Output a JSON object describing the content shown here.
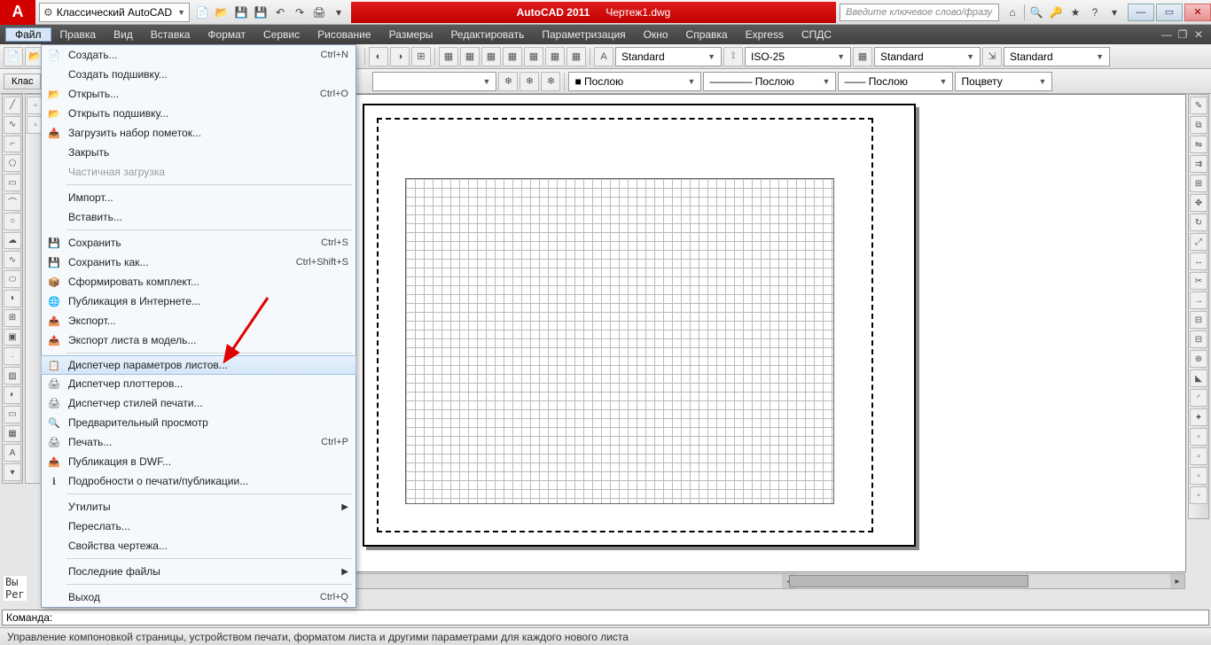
{
  "title": {
    "app": "AutoCAD 2011",
    "doc": "Чертеж1.dwg"
  },
  "workspace": "Классический AutoCAD",
  "search_placeholder": "Введите ключевое слово/фразу",
  "menubar": [
    "Файл",
    "Правка",
    "Вид",
    "Вставка",
    "Формат",
    "Сервис",
    "Рисование",
    "Размеры",
    "Редактировать",
    "Параметризация",
    "Окно",
    "Справка",
    "Express",
    "СПДС"
  ],
  "file_menu": {
    "groups": [
      [
        {
          "label": "Создать...",
          "sc": "Ctrl+N",
          "icon": "📄"
        },
        {
          "label": "Создать подшивку..."
        },
        {
          "label": "Открыть...",
          "sc": "Ctrl+O",
          "icon": "📂"
        },
        {
          "label": "Открыть подшивку...",
          "icon": "📂"
        },
        {
          "label": "Загрузить набор пометок...",
          "icon": "📥"
        },
        {
          "label": "Закрыть"
        },
        {
          "label": "Частичная загрузка",
          "disabled": true
        }
      ],
      [
        {
          "label": "Импорт..."
        },
        {
          "label": "Вставить..."
        }
      ],
      [
        {
          "label": "Сохранить",
          "sc": "Ctrl+S",
          "icon": "💾"
        },
        {
          "label": "Сохранить как...",
          "sc": "Ctrl+Shift+S",
          "icon": "💾"
        },
        {
          "label": "Сформировать комплект...",
          "icon": "📦"
        },
        {
          "label": "Публикация в Интернете...",
          "icon": "🌐"
        },
        {
          "label": "Экспорт...",
          "icon": "📤"
        },
        {
          "label": "Экспорт листа в модель...",
          "icon": "📤"
        }
      ],
      [
        {
          "label": "Диспетчер параметров листов...",
          "icon": "📋",
          "hover": true
        },
        {
          "label": "Диспетчер плоттеров...",
          "icon": "🖨"
        },
        {
          "label": "Диспетчер стилей печати...",
          "icon": "🖨"
        },
        {
          "label": "Предварительный просмотр",
          "icon": "🔍"
        },
        {
          "label": "Печать...",
          "sc": "Ctrl+P",
          "icon": "🖨"
        },
        {
          "label": "Публикация в DWF...",
          "icon": "📤"
        },
        {
          "label": "Подробности о печати/публикации...",
          "icon": "ℹ"
        }
      ],
      [
        {
          "label": "Утилиты",
          "arrow": true
        },
        {
          "label": "Переслать..."
        },
        {
          "label": "Свойства чертежа..."
        }
      ],
      [
        {
          "label": "Последние файлы",
          "arrow": true
        }
      ],
      [
        {
          "label": "Выход",
          "sc": "Ctrl+Q"
        }
      ]
    ]
  },
  "tool_combos": {
    "text_style": "Standard",
    "dim_style": "ISO-25",
    "table_style": "Standard",
    "mleader_style": "Standard",
    "color": "■ Послою",
    "ltype": "———— Послою",
    "lweight": "—— Послою",
    "plot": "Поцвету"
  },
  "layers_panel": "Клас",
  "cmd_history": "Вы\nРег",
  "cmd_prompt": "Команда:",
  "status_text": "Управление компоновкой страницы, устройством печати, форматом листа и другими параметрами для каждого нового листа"
}
